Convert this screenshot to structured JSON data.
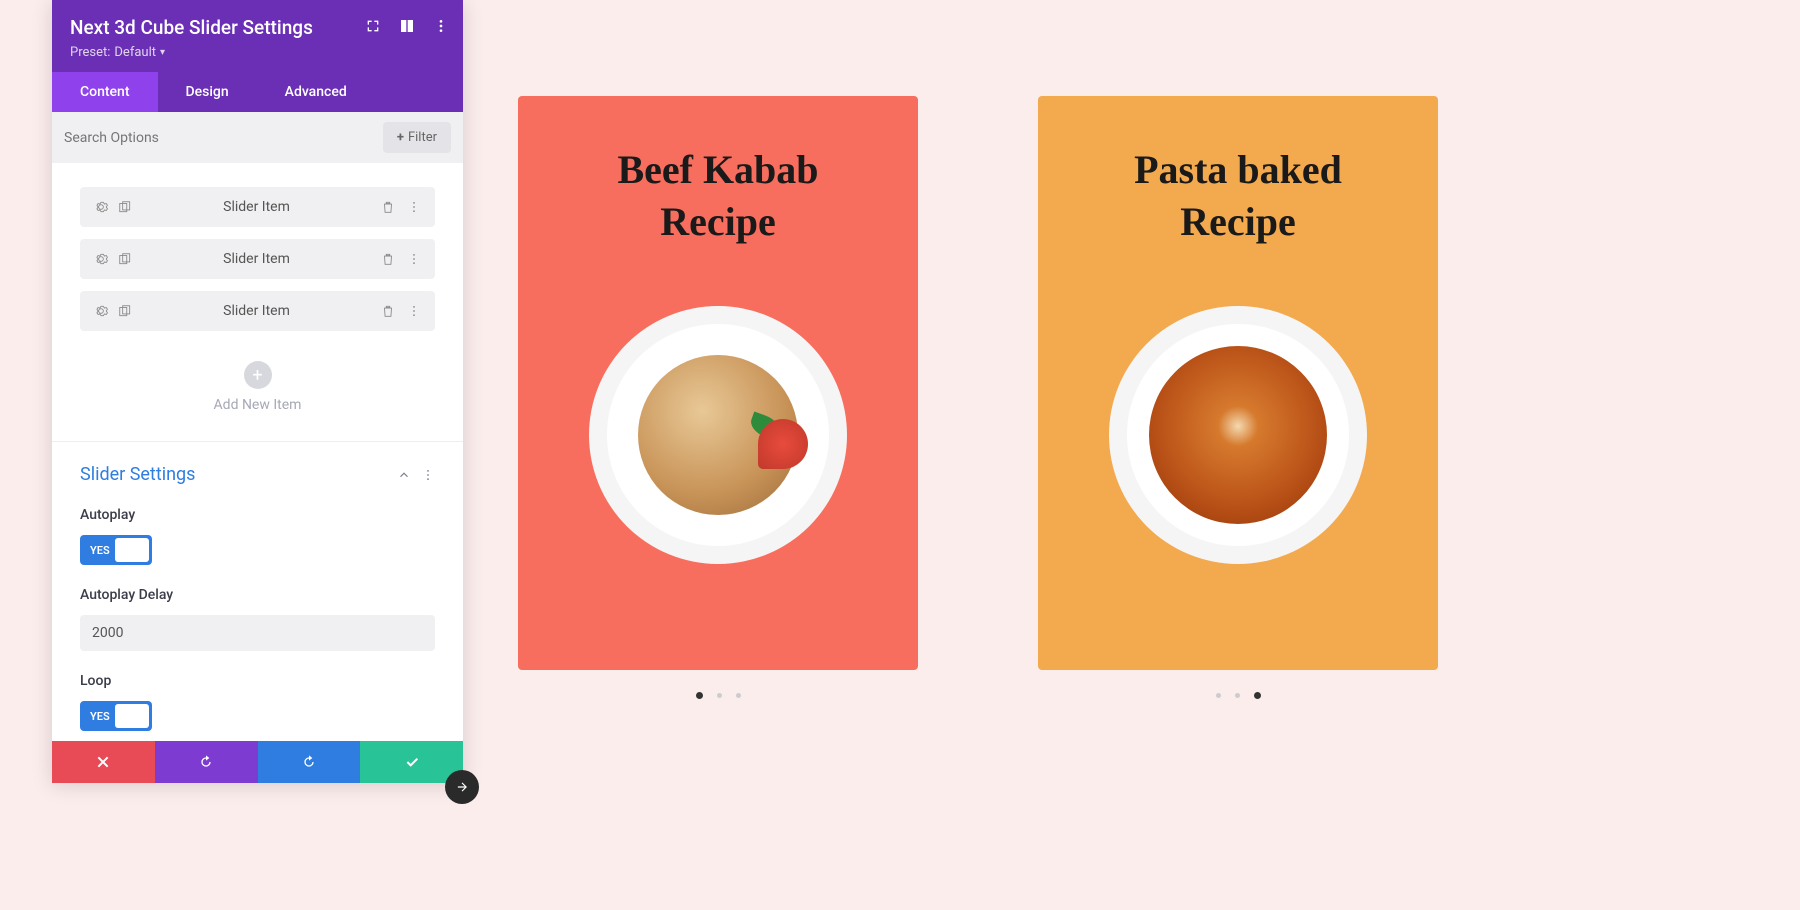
{
  "header": {
    "title": "Next 3d Cube Slider Settings",
    "preset_label": "Preset:",
    "preset_value": "Default"
  },
  "tabs": {
    "content": "Content",
    "design": "Design",
    "advanced": "Advanced"
  },
  "search": {
    "placeholder": "Search Options",
    "filter_label": "Filter"
  },
  "items": [
    {
      "label": "Slider Item"
    },
    {
      "label": "Slider Item"
    },
    {
      "label": "Slider Item"
    }
  ],
  "add_item_label": "Add New Item",
  "settings": {
    "section_title": "Slider Settings",
    "autoplay": {
      "label": "Autoplay",
      "value": "YES"
    },
    "autoplay_delay": {
      "label": "Autoplay Delay",
      "value": "2000"
    },
    "loop": {
      "label": "Loop",
      "value": "YES"
    }
  },
  "preview": {
    "card1_title": "Beef Kabab Recipe",
    "card2_title": "Pasta baked Recipe"
  }
}
